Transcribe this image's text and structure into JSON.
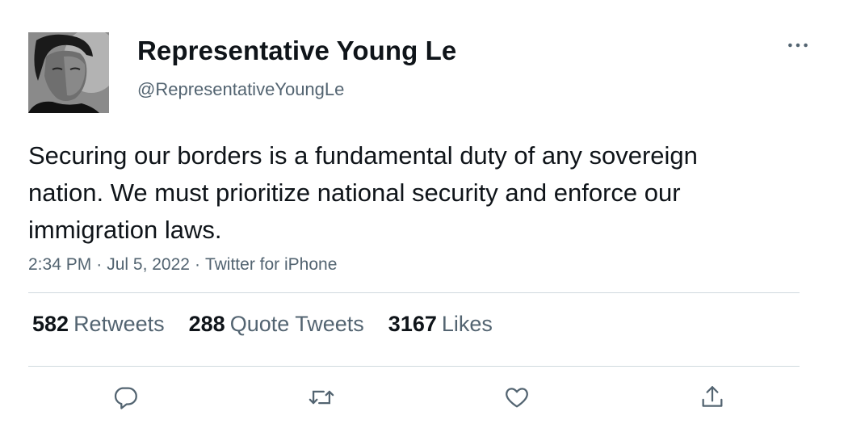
{
  "user": {
    "display_name": "Representative Young Le",
    "handle": "@RepresentativeYoungLe",
    "avatar_icon": "profile-photo"
  },
  "tweet": {
    "text": "Securing our borders is a fundamental duty of any sovereign nation. We must prioritize national security and enforce our immigration laws.",
    "time": "2:34 PM",
    "date": "Jul 5, 2022",
    "source": "Twitter for iPhone",
    "separator": "·"
  },
  "stats": {
    "retweets": {
      "count": "582",
      "label": "Retweets"
    },
    "quote_tweets": {
      "count": "288",
      "label": "Quote Tweets"
    },
    "likes": {
      "count": "3167",
      "label": "Likes"
    }
  },
  "actions": [
    {
      "icon": "reply-icon"
    },
    {
      "icon": "retweet-icon"
    },
    {
      "icon": "like-icon"
    },
    {
      "icon": "share-icon"
    }
  ],
  "colors": {
    "text": "#0f1419",
    "secondary": "#536471",
    "divider": "#cfd9de",
    "background": "#ffffff"
  }
}
